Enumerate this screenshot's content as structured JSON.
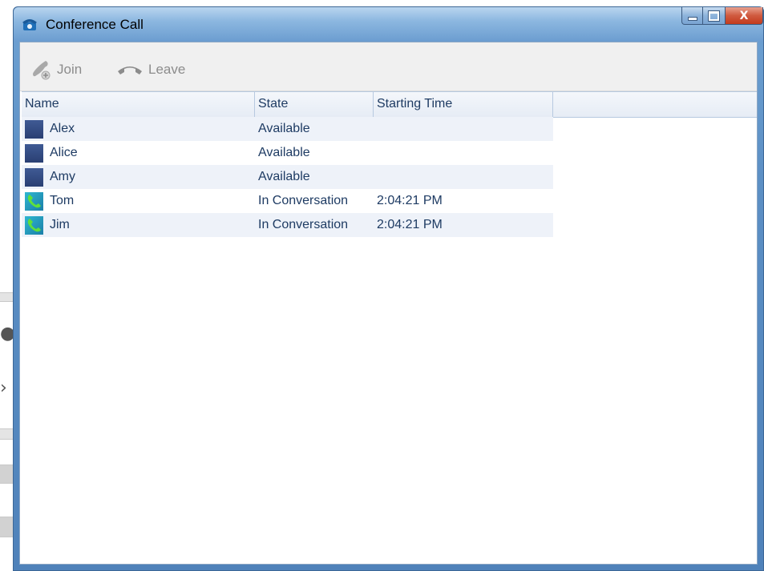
{
  "window": {
    "title": "Conference Call",
    "title_icon": "phone-icon",
    "caption": {
      "minimize_icon": "minimize-icon",
      "maximize_icon": "maximize-icon",
      "close_label": "X"
    }
  },
  "toolbar": {
    "join_label": "Join",
    "join_icon": "phone-join-icon",
    "leave_label": "Leave",
    "leave_icon": "hang-up-icon"
  },
  "grid": {
    "columns": [
      "Name",
      "State",
      "Starting Time",
      ""
    ],
    "rows": [
      {
        "name": "Alex",
        "state": "Available",
        "time": "",
        "status": "available"
      },
      {
        "name": "Alice",
        "state": "Available",
        "time": "",
        "status": "available"
      },
      {
        "name": "Amy",
        "state": "Available",
        "time": "",
        "status": "available"
      },
      {
        "name": "Tom",
        "state": "In Conversation",
        "time": "2:04:21 PM",
        "status": "in-conversation"
      },
      {
        "name": "Jim",
        "state": "In Conversation",
        "time": "2:04:21 PM",
        "status": "in-conversation"
      }
    ]
  },
  "colors": {
    "title_bar": "#8cb7e0",
    "grid_text": "#1e3b63",
    "alt_row": "#eef2f9",
    "available_status": "#2a3f73",
    "in_conversation_status": "#1a7fa8",
    "close_button": "#c33b1d"
  }
}
